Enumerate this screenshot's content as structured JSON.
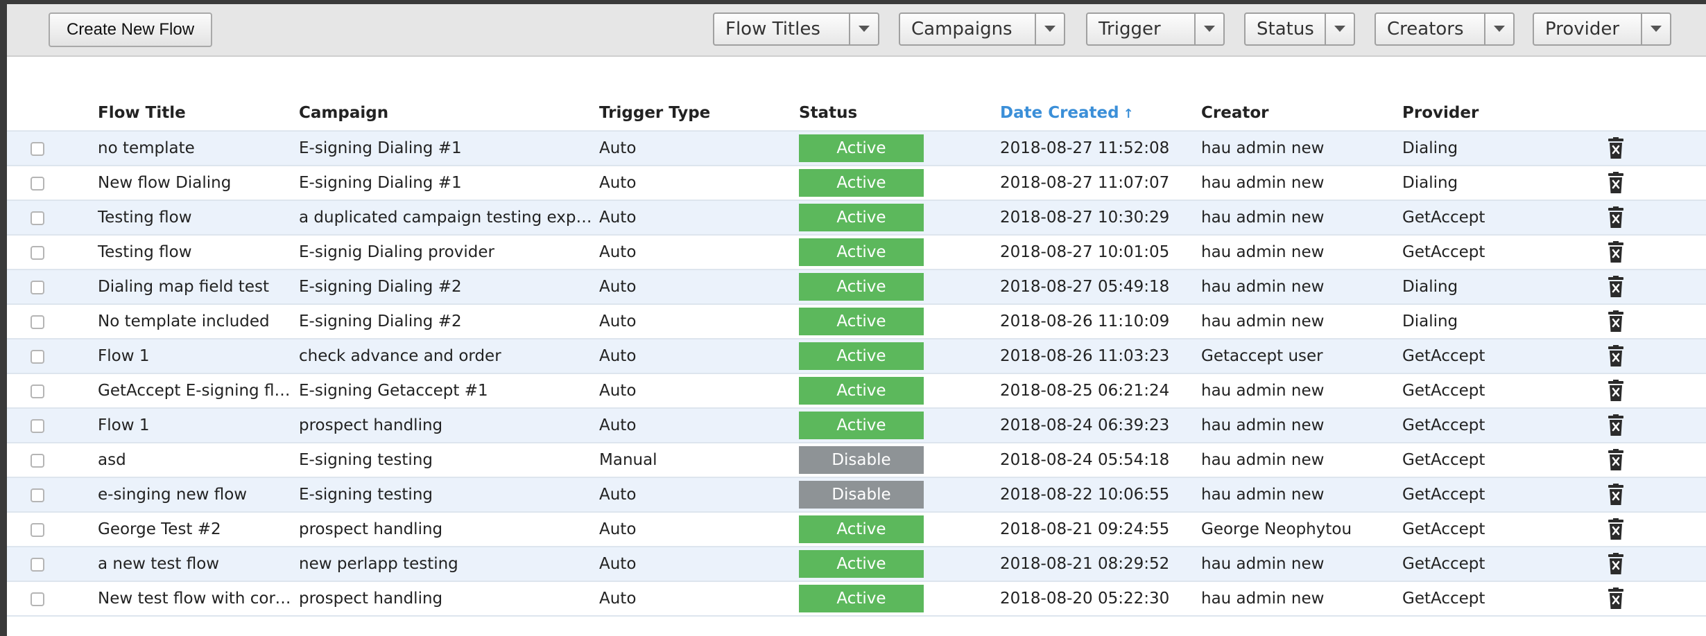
{
  "toolbar": {
    "create_label": "Create New Flow",
    "filters": [
      "Flow Titles",
      "Campaigns",
      "Trigger",
      "Status",
      "Creators",
      "Provider"
    ]
  },
  "table": {
    "headers": {
      "title": "Flow Title",
      "campaign": "Campaign",
      "trigger": "Trigger Type",
      "status": "Status",
      "date": "Date Created",
      "creator": "Creator",
      "provider": "Provider"
    },
    "sort_indicator": "↑",
    "rows": [
      {
        "title": "no template",
        "campaign": "E-signing Dialing #1",
        "trigger": "Auto",
        "status": "Active",
        "date": "2018-08-27 11:52:08",
        "creator": "hau admin new",
        "provider": "Dialing"
      },
      {
        "title": "New flow Dialing",
        "campaign": "E-signing Dialing #1",
        "trigger": "Auto",
        "status": "Active",
        "date": "2018-08-27 11:07:07",
        "creator": "hau admin new",
        "provider": "Dialing"
      },
      {
        "title": "Testing flow",
        "campaign": "a duplicated campaign testing export",
        "trigger": "Auto",
        "status": "Active",
        "date": "2018-08-27 10:30:29",
        "creator": "hau admin new",
        "provider": "GetAccept"
      },
      {
        "title": "Testing flow",
        "campaign": "E-signig Dialing provider",
        "trigger": "Auto",
        "status": "Active",
        "date": "2018-08-27 10:01:05",
        "creator": "hau admin new",
        "provider": "GetAccept"
      },
      {
        "title": "Dialing map field test",
        "campaign": "E-signing Dialing #2",
        "trigger": "Auto",
        "status": "Active",
        "date": "2018-08-27 05:49:18",
        "creator": "hau admin new",
        "provider": "Dialing"
      },
      {
        "title": "No template included",
        "campaign": "E-signing Dialing #2",
        "trigger": "Auto",
        "status": "Active",
        "date": "2018-08-26 11:10:09",
        "creator": "hau admin new",
        "provider": "Dialing"
      },
      {
        "title": "Flow 1",
        "campaign": "check advance and order",
        "trigger": "Auto",
        "status": "Active",
        "date": "2018-08-26 11:03:23",
        "creator": "Getaccept user",
        "provider": "GetAccept"
      },
      {
        "title": "GetAccept E-signing flo...",
        "campaign": "E-signing Getaccept #1",
        "trigger": "Auto",
        "status": "Active",
        "date": "2018-08-25 06:21:24",
        "creator": "hau admin new",
        "provider": "GetAccept"
      },
      {
        "title": "Flow 1",
        "campaign": "prospect handling",
        "trigger": "Auto",
        "status": "Active",
        "date": "2018-08-24 06:39:23",
        "creator": "hau admin new",
        "provider": "GetAccept"
      },
      {
        "title": "asd",
        "campaign": "E-signing testing",
        "trigger": "Manual",
        "status": "Disable",
        "date": "2018-08-24 05:54:18",
        "creator": "hau admin new",
        "provider": "GetAccept"
      },
      {
        "title": "e-singing new flow",
        "campaign": "E-signing testing",
        "trigger": "Auto",
        "status": "Disable",
        "date": "2018-08-22 10:06:55",
        "creator": "hau admin new",
        "provider": "GetAccept"
      },
      {
        "title": "George Test #2",
        "campaign": "prospect handling",
        "trigger": "Auto",
        "status": "Active",
        "date": "2018-08-21 09:24:55",
        "creator": "George Neophytou",
        "provider": "GetAccept"
      },
      {
        "title": "a new test flow",
        "campaign": "new perlapp testing",
        "trigger": "Auto",
        "status": "Active",
        "date": "2018-08-21 08:29:52",
        "creator": "hau admin new",
        "provider": "GetAccept"
      },
      {
        "title": "New test flow with corre...",
        "campaign": "prospect handling",
        "trigger": "Auto",
        "status": "Active",
        "date": "2018-08-20 05:22:30",
        "creator": "hau admin new",
        "provider": "GetAccept"
      }
    ]
  },
  "colors": {
    "active": "#5cb85c",
    "disable": "#8e9396",
    "sort_header": "#3b8fd8",
    "row_alt": "#ebf2fb"
  },
  "icons": {
    "filter_arrow": "chevron-down-icon",
    "row_action": "trash-icon"
  }
}
